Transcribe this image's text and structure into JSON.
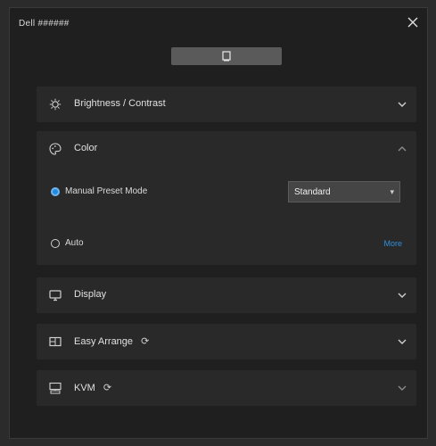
{
  "window": {
    "title": "Dell ######",
    "close_icon": "close-icon"
  },
  "monitor_selector": {
    "icon": "monitor-icon"
  },
  "sections": {
    "brightness": {
      "label": "Brightness / Contrast",
      "icon": "brightness-icon",
      "expanded": false
    },
    "color": {
      "label": "Color",
      "icon": "color-palette-icon",
      "expanded": true,
      "preset_option": {
        "label": "Manual Preset Mode",
        "selected": true
      },
      "preset_value": "Standard",
      "auto_option": {
        "label": "Auto",
        "selected": false
      },
      "more_link": "More"
    },
    "display": {
      "label": "Display",
      "icon": "display-icon",
      "expanded": false
    },
    "easy_arrange": {
      "label": "Easy Arrange",
      "icon": "easy-arrange-icon",
      "expanded": false
    },
    "kvm": {
      "label": "KVM",
      "icon": "kvm-icon",
      "expanded": false
    }
  },
  "colors": {
    "accent": "#1e8be0",
    "link": "#2f8fdc",
    "panel": "#292929",
    "background": "#1f1f1f"
  }
}
